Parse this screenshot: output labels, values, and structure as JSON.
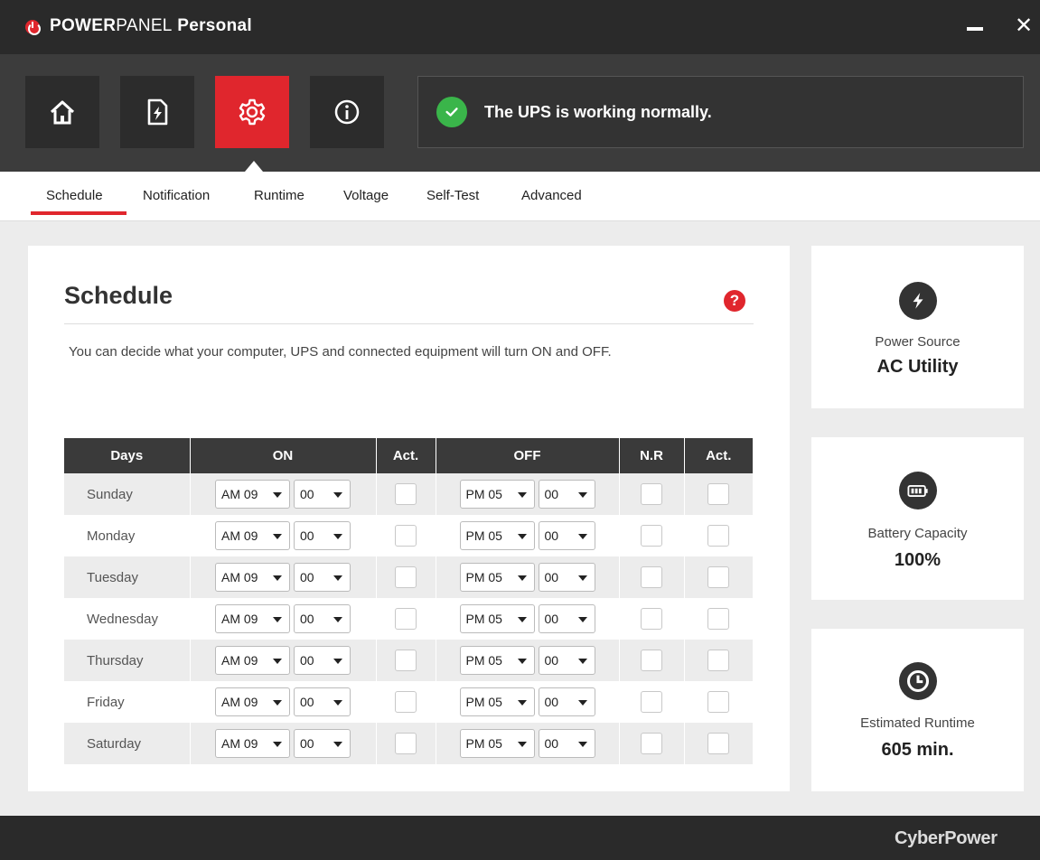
{
  "app": {
    "title_bold1": "POWER",
    "title_mid": "PANEL",
    "title_bold2": " Personal",
    "brand": "CyberPower"
  },
  "nav": {
    "items": [
      "home-icon",
      "power-document-icon",
      "settings-gear-icon",
      "info-icon"
    ],
    "active": "settings-gear-icon"
  },
  "status": {
    "text": "The UPS is working normally.",
    "color": "#3ab54a"
  },
  "tabs": [
    "Schedule",
    "Notification",
    "Runtime",
    "Voltage",
    "Self-Test",
    "Advanced"
  ],
  "main": {
    "title": "Schedule",
    "description": "You can decide what your computer, UPS and connected equipment will turn ON and OFF."
  },
  "table": {
    "headers": [
      "Days",
      "ON",
      "Act.",
      "OFF",
      "N.R",
      "Act."
    ],
    "rows": [
      {
        "day": "Sunday",
        "on_ap": "AM 09",
        "on_min": "00",
        "off_ap": "PM 05",
        "off_min": "00"
      },
      {
        "day": "Monday",
        "on_ap": "AM 09",
        "on_min": "00",
        "off_ap": "PM 05",
        "off_min": "00"
      },
      {
        "day": "Tuesday",
        "on_ap": "AM 09",
        "on_min": "00",
        "off_ap": "PM 05",
        "off_min": "00"
      },
      {
        "day": "Wednesday",
        "on_ap": "AM 09",
        "on_min": "00",
        "off_ap": "PM 05",
        "off_min": "00"
      },
      {
        "day": "Thursday",
        "on_ap": "AM 09",
        "on_min": "00",
        "off_ap": "PM 05",
        "off_min": "00"
      },
      {
        "day": "Friday",
        "on_ap": "AM 09",
        "on_min": "00",
        "off_ap": "PM 05",
        "off_min": "00"
      },
      {
        "day": "Saturday",
        "on_ap": "AM 09",
        "on_min": "00",
        "off_ap": "PM 05",
        "off_min": "00"
      }
    ]
  },
  "cards": {
    "power": {
      "label": "Power Source",
      "value": "AC Utility",
      "icon": "lightning-icon"
    },
    "battery": {
      "label": "Battery Capacity",
      "value": "100%",
      "icon": "battery-icon"
    },
    "runtime": {
      "label": "Estimated Runtime",
      "value": "605 min.",
      "icon": "clock-icon"
    }
  },
  "colors": {
    "accent": "#e0262d",
    "dark": "#2a2a2a"
  }
}
